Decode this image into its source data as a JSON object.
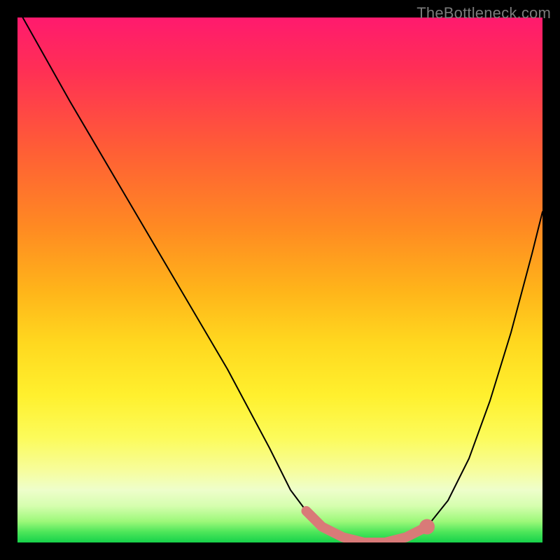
{
  "watermark": {
    "text": "TheBottleneck.com"
  },
  "chart_data": {
    "type": "line",
    "title": "",
    "xlabel": "",
    "ylabel": "",
    "x_range": [
      0,
      100
    ],
    "y_range": [
      0,
      100
    ],
    "series": [
      {
        "name": "bottleneck-curve",
        "x": [
          1,
          10,
          20,
          30,
          40,
          48,
          52,
          55,
          58,
          62,
          66,
          70,
          74,
          78,
          82,
          86,
          90,
          94,
          98,
          100
        ],
        "y": [
          100,
          84,
          67,
          50,
          33,
          18,
          10,
          6,
          3,
          1,
          0,
          0,
          1,
          3,
          8,
          16,
          27,
          40,
          55,
          63
        ]
      }
    ],
    "optimal_zone": {
      "name": "optimal-range-marker",
      "color": "#d97a78",
      "x": [
        55,
        58,
        62,
        66,
        70,
        74,
        78
      ],
      "y": [
        6,
        3,
        1,
        0,
        0,
        1,
        3
      ],
      "endpoint_dot": {
        "x": 78,
        "y": 3,
        "r": 1.5
      }
    },
    "background_gradient": {
      "type": "vertical",
      "stops": [
        {
          "pos": 0.0,
          "color": "#ff1a6e"
        },
        {
          "pos": 0.5,
          "color": "#ffb41a"
        },
        {
          "pos": 0.8,
          "color": "#fcfb5a"
        },
        {
          "pos": 1.0,
          "color": "#16d24a"
        }
      ]
    }
  }
}
